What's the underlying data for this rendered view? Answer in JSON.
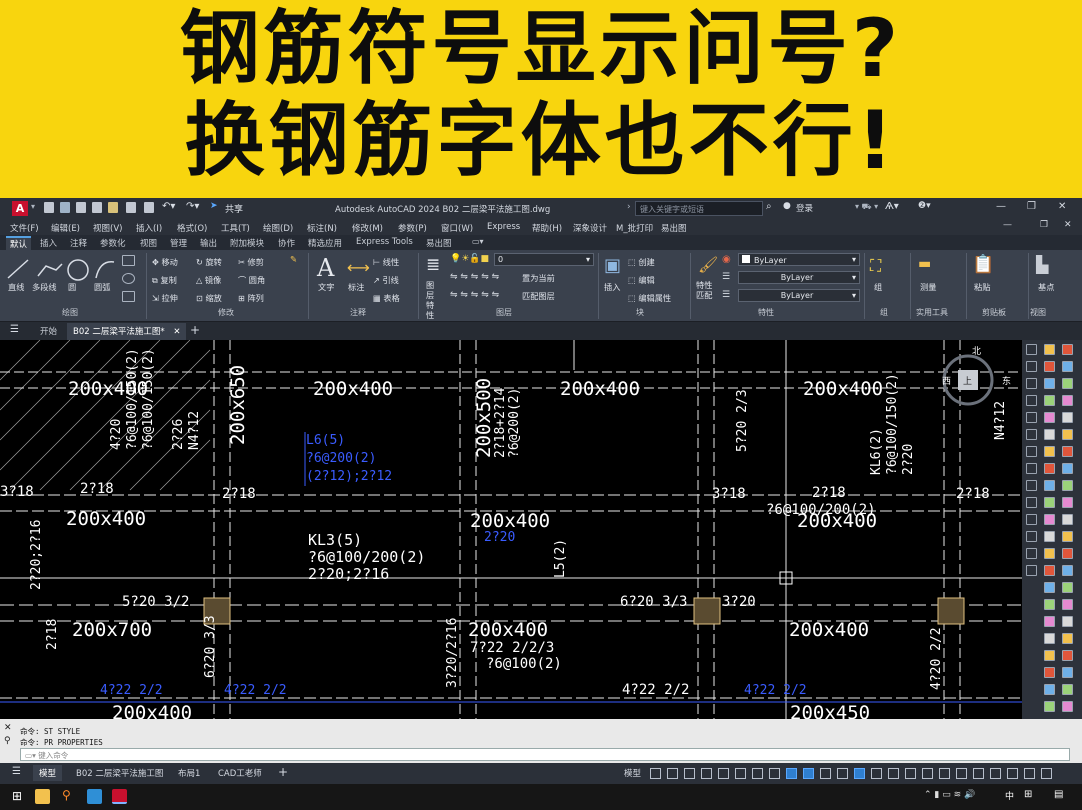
{
  "banner": {
    "line1": "钢筋符号显示问号?",
    "line2": "换钢筋字体也不行!"
  },
  "titlebar": {
    "share_label": "共享",
    "window_title": "Autodesk AutoCAD 2024   B02 二层梁平法施工图.dwg",
    "search_placeholder": "键入关键字或短语",
    "signin_label": "登录"
  },
  "menubar": [
    "文件(F)",
    "编辑(E)",
    "视图(V)",
    "插入(I)",
    "格式(O)",
    "工具(T)",
    "绘图(D)",
    "标注(N)",
    "修改(M)",
    "参数(P)",
    "窗口(W)",
    "Express",
    "帮助(H)",
    "深象设计",
    "M_批打印",
    "易出图"
  ],
  "ribbon_tabs": [
    "默认",
    "插入",
    "注释",
    "参数化",
    "视图",
    "管理",
    "输出",
    "附加模块",
    "协作",
    "精选应用",
    "Express Tools",
    "易出图"
  ],
  "ribbon": {
    "draw_tools": [
      "直线",
      "多段线",
      "圆",
      "圆弧"
    ],
    "modify_tools": [
      "移动",
      "旋转",
      "修剪",
      "复制",
      "镜像",
      "圆角",
      "拉伸",
      "缩放",
      "阵列"
    ],
    "annotation_tools": [
      "文字",
      "标注",
      "线性",
      "引线",
      "表格"
    ],
    "layer_tools": [
      "图层特性",
      "置为当前",
      "匹配图层"
    ],
    "layer_value": "0",
    "block_tools": [
      "插入",
      "创建",
      "编辑",
      "编辑属性"
    ],
    "props_tools": [
      "特性匹配"
    ],
    "prop_values": [
      "ByLayer",
      "ByLayer",
      "ByLayer"
    ],
    "group_label": "组",
    "util_label": "测量",
    "clip_label": "粘贴",
    "view_label": "基点",
    "panels": [
      "绘图",
      "修改",
      "注释",
      "图层",
      "块",
      "特性",
      "组",
      "实用工具",
      "剪贴板",
      "视图"
    ]
  },
  "doc_tabs": {
    "start": "开始",
    "active": "B02 二层梁平法施工图*"
  },
  "drawing": {
    "beam_labels": [
      "200x400",
      "200x650",
      "200x400",
      "200x400",
      "200x500",
      "200x400",
      "200x400",
      "200x400",
      "200x400",
      "200x700",
      "200x400",
      "200x400",
      "200x400",
      "200x450"
    ],
    "rebar_notes": [
      "3?18",
      "2?18",
      "3?18",
      "2?18",
      "2?18",
      "2?18",
      "5?20 3/2",
      "6?20 3/3",
      "3?20",
      "4?22 2/2",
      "4?22 2/2",
      "4?22 2/2",
      "4?22 2/2",
      "7?22 2/2/3",
      "?6@100(2)",
      "?6@100/150(2)",
      "?6@200(2)",
      "L6(5)",
      "(2?12);2?12",
      "KL3(5)",
      "?6@100/200(2)",
      "2?20;2?16",
      "KL6(2)",
      "2?20",
      "?6@100/200(2)",
      "?6@100/150(2)",
      "2?18",
      "5?20 2/3",
      "2?18+2?14",
      "4?20",
      "N4?12",
      "6?20 3/3",
      "3?20/2?16",
      "4?20 2/2",
      "2?26",
      "N4?12",
      "L5(2)"
    ],
    "compass": [
      "北",
      "西",
      "东",
      "上"
    ]
  },
  "command": {
    "line1": "命令: ST STYLE",
    "line2": "命令: PR PROPERTIES",
    "placeholder": "键入命令"
  },
  "status_tabs": [
    "模型",
    "B02 二层梁平法施工图",
    "布局1",
    "CAD工老师"
  ],
  "status_right": "模型",
  "taskbar": {
    "ime": "中",
    "time_hidden": ""
  }
}
